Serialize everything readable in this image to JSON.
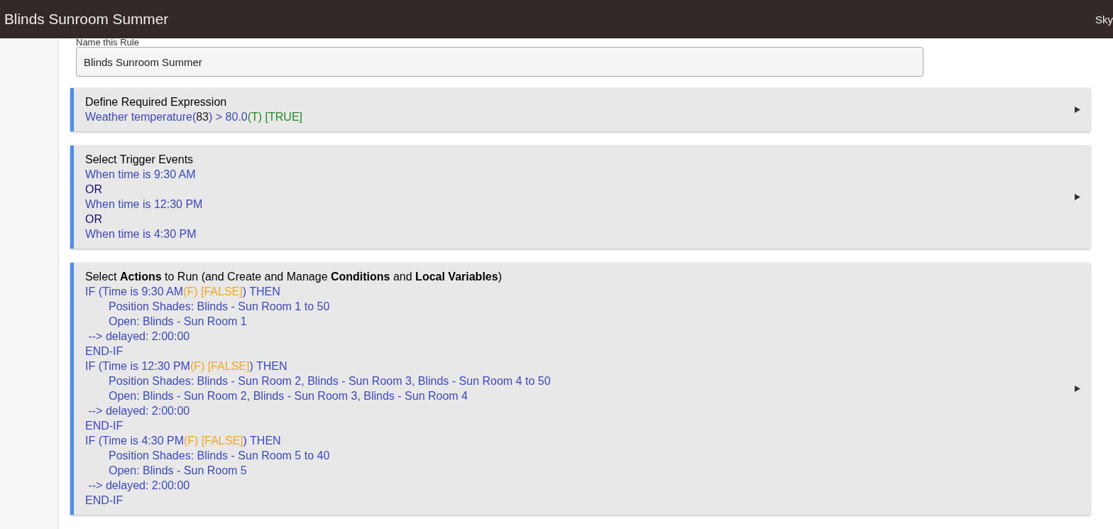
{
  "header": {
    "title": "Blinds Sunroom Summer",
    "user": "Sky"
  },
  "name_field": {
    "label": "Name this Rule",
    "value": "Blinds Sunroom Summer"
  },
  "sections": [
    {
      "title": "Define Required Expression",
      "lines": [
        {
          "indented": false,
          "segments": [
            {
              "kind": "text",
              "text": "Weather temperature("
            },
            {
              "kind": "value",
              "text": "83"
            },
            {
              "kind": "text",
              "text": ") > 80.0"
            },
            {
              "kind": "true",
              "text": "(T) [TRUE]"
            }
          ]
        }
      ]
    },
    {
      "title": "Select Trigger Events",
      "lines": [
        {
          "indented": false,
          "segments": [
            {
              "kind": "text",
              "text": "When time is 9:30 AM"
            }
          ]
        },
        {
          "indented": false,
          "segments": [
            {
              "kind": "operator",
              "text": "OR"
            }
          ]
        },
        {
          "indented": false,
          "segments": [
            {
              "kind": "text",
              "text": "When time is 12:30 PM"
            }
          ]
        },
        {
          "indented": false,
          "segments": [
            {
              "kind": "operator",
              "text": "OR"
            }
          ]
        },
        {
          "indented": false,
          "segments": [
            {
              "kind": "text",
              "text": "When time is 4:30 PM"
            }
          ]
        }
      ]
    },
    {
      "title": "Select **Actions** to Run (and Create and Manage **Conditions** and **Local Variables**)",
      "lines": [
        {
          "indented": false,
          "segments": [
            {
              "kind": "text",
              "text": "IF (Time is 9:30 AM"
            },
            {
              "kind": "false",
              "text": "(F) [FALSE]"
            },
            {
              "kind": "text",
              "text": ") THEN"
            }
          ]
        },
        {
          "indented": true,
          "segments": [
            {
              "kind": "text",
              "text": "Position Shades: Blinds - Sun Room 1 to 50"
            }
          ]
        },
        {
          "indented": true,
          "segments": [
            {
              "kind": "text",
              "text": "Open: Blinds - Sun Room 1"
            }
          ]
        },
        {
          "indented": false,
          "segments": [
            {
              "kind": "text",
              "text": " --> delayed: 2:00:00"
            }
          ]
        },
        {
          "indented": false,
          "segments": [
            {
              "kind": "text",
              "text": "END-IF"
            }
          ]
        },
        {
          "indented": false,
          "segments": [
            {
              "kind": "text",
              "text": "IF (Time is 12:30 PM"
            },
            {
              "kind": "false",
              "text": "(F) [FALSE]"
            },
            {
              "kind": "text",
              "text": ") THEN"
            }
          ]
        },
        {
          "indented": true,
          "segments": [
            {
              "kind": "text",
              "text": "Position Shades: Blinds - Sun Room 2, Blinds - Sun Room 3, Blinds - Sun Room 4 to 50"
            }
          ]
        },
        {
          "indented": true,
          "segments": [
            {
              "kind": "text",
              "text": "Open: Blinds - Sun Room 2, Blinds - Sun Room 3, Blinds - Sun Room 4"
            }
          ]
        },
        {
          "indented": false,
          "segments": [
            {
              "kind": "text",
              "text": " --> delayed: 2:00:00"
            }
          ]
        },
        {
          "indented": false,
          "segments": [
            {
              "kind": "text",
              "text": "END-IF"
            }
          ]
        },
        {
          "indented": false,
          "segments": [
            {
              "kind": "text",
              "text": "IF (Time is 4:30 PM"
            },
            {
              "kind": "false",
              "text": "(F) [FALSE]"
            },
            {
              "kind": "text",
              "text": ") THEN"
            }
          ]
        },
        {
          "indented": true,
          "segments": [
            {
              "kind": "text",
              "text": "Position Shades: Blinds - Sun Room 5 to 40"
            }
          ]
        },
        {
          "indented": true,
          "segments": [
            {
              "kind": "text",
              "text": "Open: Blinds - Sun Room 5"
            }
          ]
        },
        {
          "indented": false,
          "segments": [
            {
              "kind": "text",
              "text": " --> delayed: 2:00:00"
            }
          ]
        },
        {
          "indented": false,
          "segments": [
            {
              "kind": "text",
              "text": "END-IF"
            }
          ]
        }
      ]
    }
  ]
}
